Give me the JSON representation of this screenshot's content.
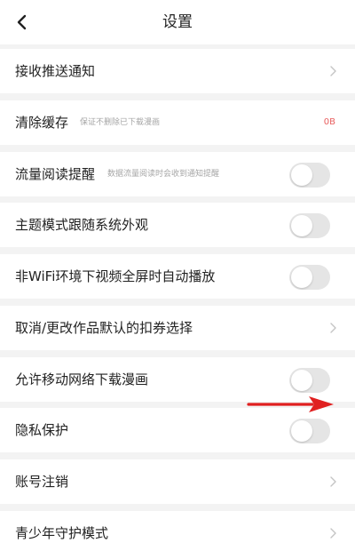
{
  "header": {
    "title": "设置",
    "back_icon": "chevron-left-icon"
  },
  "rows": {
    "push_notifications": {
      "label": "接收推送通知"
    },
    "clear_cache": {
      "label": "清除缓存",
      "sub": "保证不删除已下载漫画",
      "value": "0B"
    },
    "data_reminder": {
      "label": "流量阅读提醒",
      "sub": "数据流量阅读时会收到通知提醒",
      "toggle_on": false
    },
    "theme_follow": {
      "label": "主题模式跟随系统外观",
      "toggle_on": false
    },
    "non_wifi_video": {
      "label": "非WiFi环境下视频全屏时自动播放",
      "toggle_on": false
    },
    "default_coupon": {
      "label": "取消/更改作品默认的扣券选择"
    },
    "mobile_download": {
      "label": "允许移动网络下载漫画",
      "toggle_on": false
    },
    "privacy": {
      "label": "隐私保护",
      "toggle_on": false
    },
    "account_cancel": {
      "label": "账号注销"
    },
    "youth_mode": {
      "label": "青少年守护模式"
    }
  },
  "annotation": {
    "arrow_color": "#e02020",
    "arrow_icon": "red-arrow-annotation"
  },
  "colors": {
    "background": "#f3f3f3",
    "row_background": "#ffffff",
    "toggle_off": "#e5e5e5",
    "cache_value": "#e86060"
  }
}
